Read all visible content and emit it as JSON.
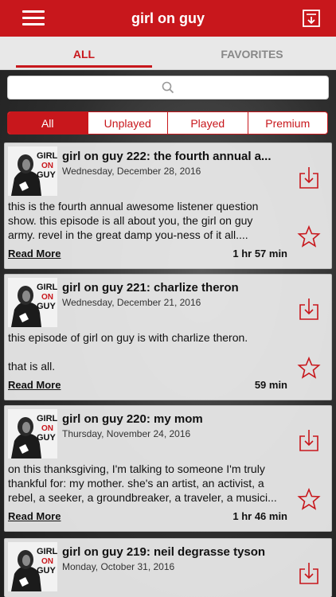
{
  "header": {
    "title": "girl on guy"
  },
  "tabs": [
    {
      "label": "ALL",
      "active": true
    },
    {
      "label": "FAVORITES",
      "active": false
    }
  ],
  "search": {
    "placeholder": "",
    "value": ""
  },
  "filters": [
    {
      "label": "All",
      "active": true
    },
    {
      "label": "Unplayed",
      "active": false
    },
    {
      "label": "Played",
      "active": false
    },
    {
      "label": "Premium",
      "active": false
    }
  ],
  "logo": {
    "line1": "GIRL",
    "line2": "ON",
    "line3": "GUY"
  },
  "episodes": [
    {
      "title": "girl on guy 222: the fourth annual a...",
      "date": "Wednesday, December 28, 2016",
      "description": "this is the fourth annual awesome listener question\nshow. this episode is all about you, the girl on guy\narmy. revel in the great damp you-ness of it all....",
      "read_more": "Read More",
      "duration": "1 hr 57 min"
    },
    {
      "title": "girl on guy 221: charlize theron",
      "date": "Wednesday, December 21, 2016",
      "description": "this episode of girl on guy is with charlize theron.\n\nthat is all.",
      "read_more": "Read More",
      "duration": "59 min"
    },
    {
      "title": "girl on guy 220: my mom",
      "date": "Thursday, November 24, 2016",
      "description": "on this thanksgiving, I'm talking to someone I'm truly\nthankful for: my mother. she's an artist, an activist, a\nrebel, a seeker, a groundbreaker, a traveler, a musici...",
      "read_more": "Read More",
      "duration": "1 hr 46 min"
    },
    {
      "title": "girl on guy 219: neil degrasse tyson",
      "date": "Monday, October 31, 2016",
      "description": "",
      "read_more": "",
      "duration": ""
    }
  ],
  "colors": {
    "accent": "#c8171c",
    "bar_bg": "#e8e8e8"
  },
  "icons": {
    "menu": "hamburger-menu-icon",
    "download_all": "download-list-icon",
    "search": "magnifier-icon",
    "download": "download-icon",
    "favorite": "star-outline-icon"
  }
}
